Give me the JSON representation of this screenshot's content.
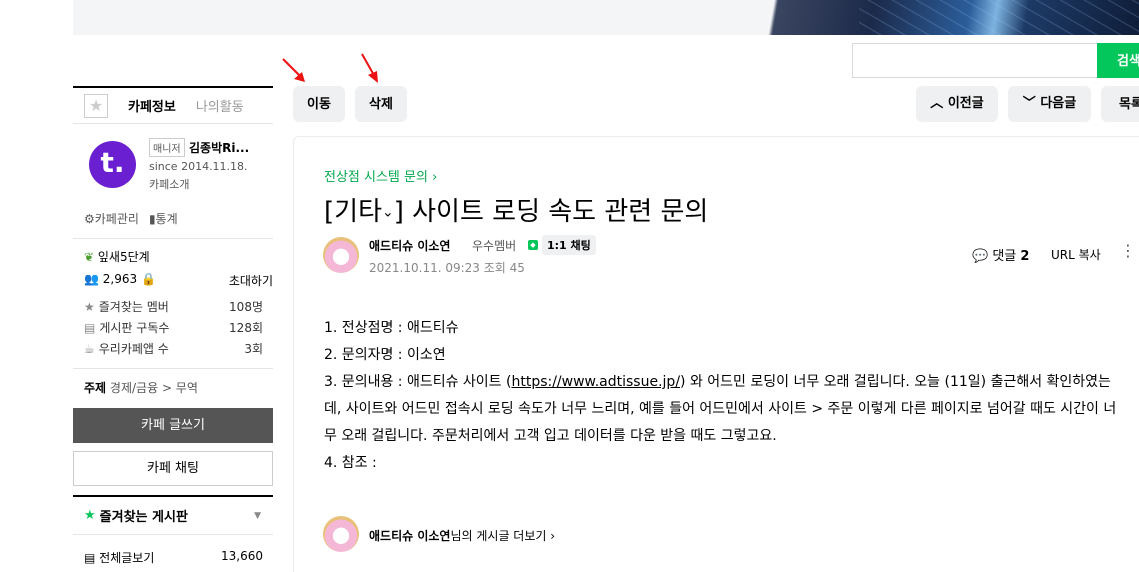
{
  "search": {
    "button_label": "검색",
    "placeholder": ""
  },
  "sidebar": {
    "tab_info": "카페정보",
    "tab_activity": "나의활동",
    "logo_text": "t.",
    "manager_tag": "매니저",
    "manager_name": "김종박Ri...",
    "since": "since 2014.11.18.",
    "cafe_intro": "카페소개",
    "admin_label": "카페관리",
    "stats_label": "통계",
    "level": "잎새5단계",
    "member_count": "2,963",
    "invite": "초대하기",
    "stats": [
      {
        "label": "즐겨찾는 멤버",
        "value": "108명"
      },
      {
        "label": "게시판 구독수",
        "value": "128회"
      },
      {
        "label": "우리카페앱 수",
        "value": "3회"
      }
    ],
    "topic_label": "주제",
    "topic_value": "경제/금융 > 무역",
    "write_button": "카페 글쓰기",
    "chat_button": "카페 채팅",
    "fav_board_header": "즐겨찾는 게시판",
    "all_posts_label": "전체글보기",
    "all_posts_count": "13,660"
  },
  "toolbar": {
    "move": "이동",
    "delete": "삭제",
    "prev": "이전글",
    "next": "다음글",
    "list": "목록"
  },
  "article": {
    "breadcrumb": "전상점 시스템 문의",
    "title_prefix": "[기타",
    "title_main": "] 사이트 로딩 속도 관련 문의",
    "author": "애드티슈 이소연",
    "grade": "우수멤버",
    "chat_chip": "1:1 채팅",
    "date": "2021.10.11. 09:23",
    "views_label": "조회 45",
    "comments_label": "댓글",
    "comments_count": "2",
    "url_copy": "URL 복사",
    "lines": [
      "1. 전상점명 : 애드티슈",
      "2. 문의자명 : 이소연"
    ],
    "line3_a": "3. 문의내용 : 애드티슈 사이트 (",
    "line3_link": "https://www.adtissue.jp/",
    "line3_b": ") 와 어드민 로딩이 너무 오래 걸립니다. 오늘 (11일) 출근해서 확인하였는데, 사이트와 어드민 접속시 로딩 속도가 너무 느리며, 예를 들어 어드민에서 사이트 > 주문 이렇게 다른 페이지로 넘어갈 때도 시간이 너무 오래 걸립니다. 주문처리에서 고객 입고 데이터를 다운 받을 때도 그렇고요.",
    "line4": "4. 참조 :",
    "footer_author": "애드티슈 이소연",
    "footer_suffix": "님의 게시글 더보기"
  },
  "colors": {
    "accent_green": "#03c75a",
    "annotation_red": "#ee1111"
  }
}
